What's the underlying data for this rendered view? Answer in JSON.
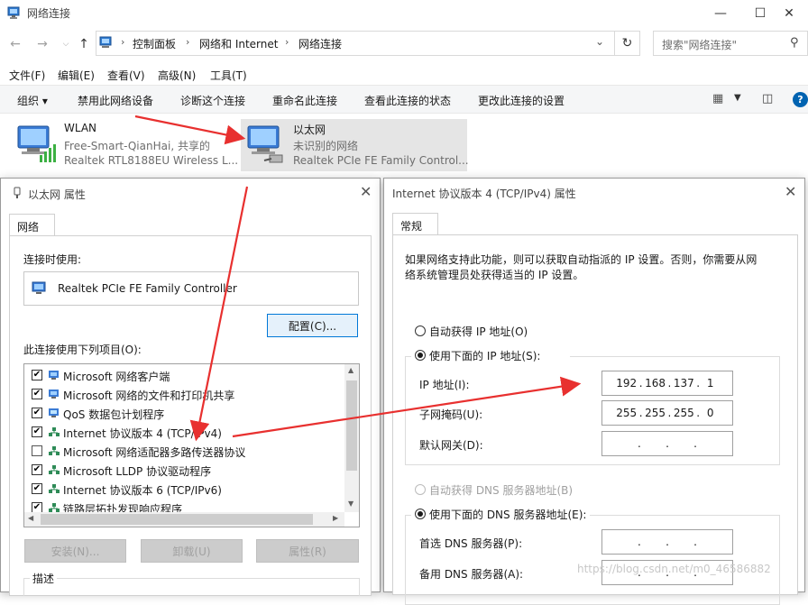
{
  "explorer": {
    "window_title": "网络连接",
    "breadcrumb": [
      "控制面板",
      "网络和 Internet",
      "网络连接"
    ],
    "search_placeholder": "搜索\"网络连接\"",
    "menu": [
      "文件(F)",
      "编辑(E)",
      "查看(V)",
      "高级(N)",
      "工具(T)"
    ],
    "commands": [
      "组织 ▾",
      "禁用此网络设备",
      "诊断这个连接",
      "重命名此连接",
      "查看此连接的状态",
      "更改此连接的设置"
    ],
    "connections": [
      {
        "name": "WLAN",
        "status": "Free-Smart-QianHai, 共享的",
        "device": "Realtek RTL8188EU Wireless L..."
      },
      {
        "name": "以太网",
        "status": "未识别的网络",
        "device": "Realtek PCIe FE Family Control..."
      }
    ]
  },
  "eth_props": {
    "title": "以太网 属性",
    "tab": "网络",
    "connect_using_label": "连接时使用:",
    "adapter_name": "Realtek PCIe FE Family Controller",
    "configure_button": "配置(C)...",
    "items_label": "此连接使用下列项目(O):",
    "items": [
      {
        "label": "Microsoft 网络客户端",
        "checked": true
      },
      {
        "label": "Microsoft 网络的文件和打印机共享",
        "checked": true
      },
      {
        "label": "QoS 数据包计划程序",
        "checked": true
      },
      {
        "label": "Internet 协议版本 4 (TCP/IPv4)",
        "checked": true
      },
      {
        "label": "Microsoft 网络适配器多路传送器协议",
        "checked": false
      },
      {
        "label": "Microsoft LLDP 协议驱动程序",
        "checked": true
      },
      {
        "label": "Internet 协议版本 6 (TCP/IPv6)",
        "checked": true
      },
      {
        "label": "链路层拓扑发现响应程序",
        "checked": true
      }
    ],
    "install_button": "安装(N)...",
    "uninstall_button": "卸载(U)",
    "properties_button": "属性(R)",
    "description_label": "描述"
  },
  "ipv4_props": {
    "title": "Internet 协议版本 4 (TCP/IPv4) 属性",
    "tab": "常规",
    "intro": [
      "如果网络支持此功能，则可以获取自动指派的 IP 设置。否则，你需要从网",
      "络系统管理员处获得适当的 IP 设置。"
    ],
    "auto_ip_label": "自动获得 IP 地址(O)",
    "manual_ip_label": "使用下面的 IP 地址(S):",
    "ip_label": "IP 地址(I):",
    "ip_value": [
      "192",
      "168",
      "137",
      "1"
    ],
    "mask_label": "子网掩码(U):",
    "mask_value": [
      "255",
      "255",
      "255",
      "0"
    ],
    "gateway_label": "默认网关(D):",
    "gateway_value": [
      "",
      "",
      "",
      ""
    ],
    "auto_dns_label": "自动获得 DNS 服务器地址(B)",
    "manual_dns_label": "使用下面的 DNS 服务器地址(E):",
    "preferred_dns_label": "首选 DNS 服务器(P):",
    "preferred_dns_value": [
      "",
      "",
      "",
      ""
    ],
    "alternate_dns_label": "备用 DNS 服务器(A):",
    "alternate_dns_value": [
      "",
      "",
      "",
      ""
    ]
  },
  "watermark": "https://blog.csdn.net/m0_46586882",
  "colors": {
    "annotation_arrow": "#e8302f",
    "help_icon": "#0063b1"
  }
}
